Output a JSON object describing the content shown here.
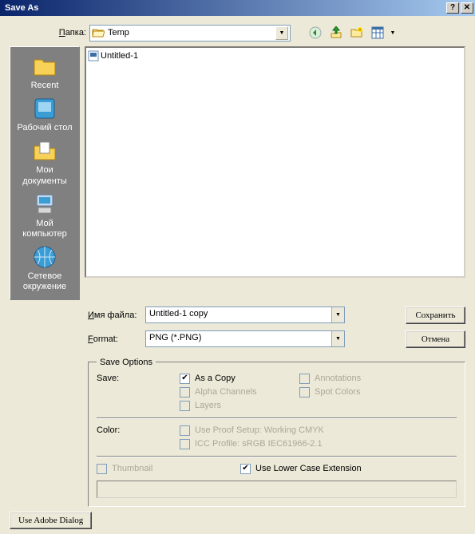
{
  "title": "Save As",
  "folder_label": "Папка:",
  "folder_value": "Temp",
  "places": [
    {
      "label": "Recent"
    },
    {
      "label": "Рабочий стол"
    },
    {
      "label": "Мои документы"
    },
    {
      "label": "Мой компьютер"
    },
    {
      "label": "Сетевое окружение"
    }
  ],
  "files": [
    {
      "name": "Untitled-1"
    }
  ],
  "filename_label": "Имя файла:",
  "filename_value": "Untitled-1 copy",
  "format_label": "Format:",
  "format_value": "PNG (*.PNG)",
  "save_btn": "Сохранить",
  "cancel_btn": "Отмена",
  "save_options": {
    "legend": "Save Options",
    "save_label": "Save:",
    "as_copy": "As a Copy",
    "alpha": "Alpha Channels",
    "layers": "Layers",
    "annotations": "Annotations",
    "spot": "Spot Colors",
    "color_label": "Color:",
    "proof": "Use Proof Setup:  Working CMYK",
    "icc": "ICC Profile:  sRGB IEC61966-2.1",
    "thumbnail": "Thumbnail",
    "lowercase": "Use Lower Case Extension"
  },
  "adobe_btn": "Use Adobe Dialog"
}
